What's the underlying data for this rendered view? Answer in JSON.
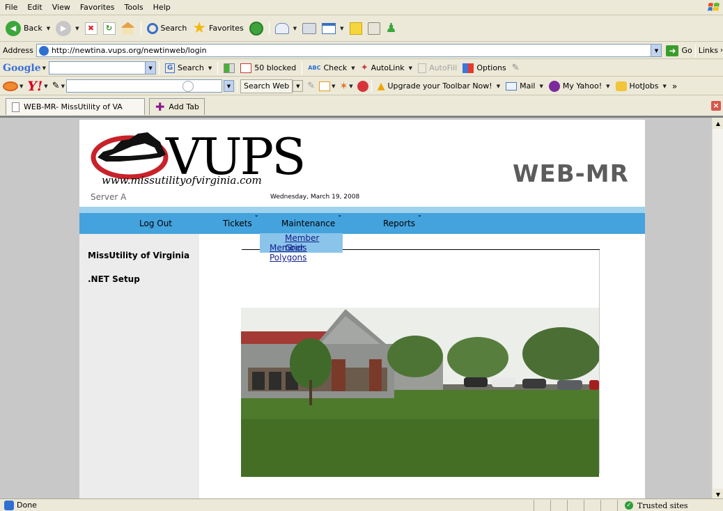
{
  "browser": {
    "menu": [
      "File",
      "Edit",
      "View",
      "Favorites",
      "Tools",
      "Help"
    ],
    "toolbar": {
      "back": "Back",
      "search": "Search",
      "favorites": "Favorites"
    },
    "address": {
      "label": "Address",
      "url": "http://newtina.vups.org/newtinweb/login",
      "go": "Go",
      "links": "Links"
    },
    "google_toolbar": {
      "brand": "Google",
      "search": "Search",
      "blocked": "50 blocked",
      "check": "Check",
      "autolink": "AutoLink",
      "autofill": "AutoFill",
      "options": "Options"
    },
    "yahoo_toolbar": {
      "brand": "Y!",
      "search_web": "Search Web",
      "upgrade": "Upgrade your Toolbar Now!",
      "mail": "Mail",
      "my_yahoo": "My Yahoo!",
      "hotjobs": "HotJobs"
    },
    "tabs": [
      {
        "label": "WEB-MR- MissUtility of VA"
      }
    ],
    "add_tab": "Add Tab",
    "status": {
      "left": "Done",
      "zone": "Trusted sites"
    }
  },
  "site": {
    "logo_text": "VUPS",
    "logo_url": "www.missutilityofvirginia.com",
    "server": "Server A",
    "date": "Wednesday, March 19, 2008",
    "app_title": "WEB-MR",
    "nav": {
      "logout": "Log Out",
      "tickets": "Tickets",
      "maintenance": "Maintenance",
      "reports": "Reports"
    },
    "maintenance_menu": [
      "Member Grids",
      "Member Polygons"
    ],
    "sidebar": [
      "MissUtility of Virginia",
      ".NET Setup"
    ]
  },
  "colors": {
    "nav_blue": "#44a2dc",
    "nav_light": "#9ed2ee",
    "dropdown": "#8ac4ea",
    "sidebar": "#ececec",
    "title_gray": "#5c5c5c"
  }
}
